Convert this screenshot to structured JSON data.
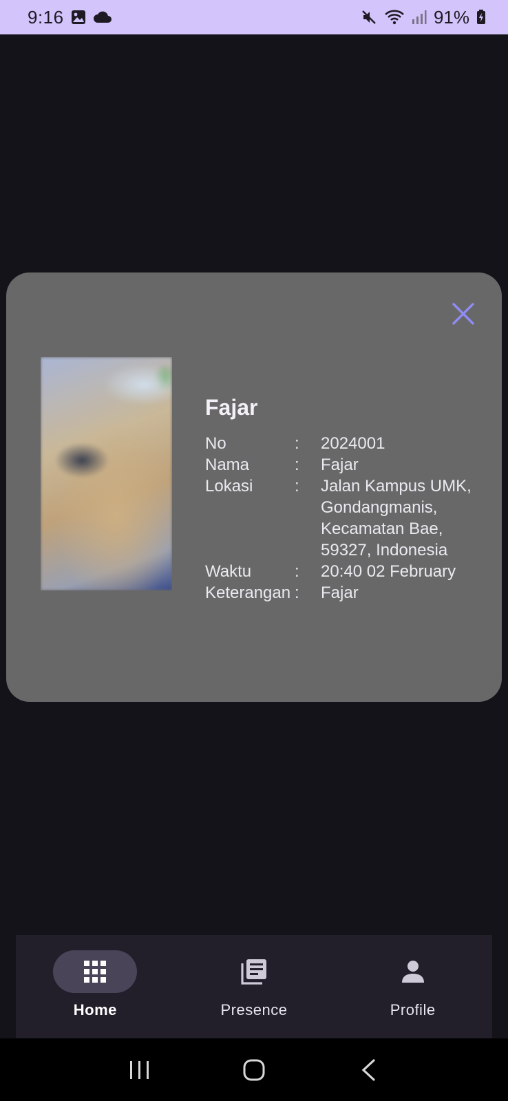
{
  "status_bar": {
    "time": "9:16",
    "battery": "91%",
    "icons": [
      "gallery-icon",
      "cloud-icon",
      "mute-icon",
      "wifi-icon",
      "signal-icon",
      "battery-charging-icon"
    ]
  },
  "dialog": {
    "close_icon": "close-icon",
    "photo_alt": "presence photo",
    "name": "Fajar",
    "rows": [
      {
        "label": "No",
        "sep": ":",
        "value": "2024001"
      },
      {
        "label": "Nama",
        "sep": ":",
        "value": "Fajar"
      },
      {
        "label": "Lokasi",
        "sep": ":",
        "value": "Jalan Kampus UMK, Gondangmanis, Kecamatan Bae, 59327, Indonesia"
      },
      {
        "label": "Waktu",
        "sep": ":",
        "value": "20:40 02 February"
      },
      {
        "label": "Keterangan",
        "sep": ":",
        "value": "Fajar"
      }
    ]
  },
  "bottom_nav": {
    "items": [
      {
        "label": "Home",
        "icon": "grid-icon",
        "active": true
      },
      {
        "label": "Presence",
        "icon": "list-icon",
        "active": false
      },
      {
        "label": "Profile",
        "icon": "person-icon",
        "active": false
      }
    ]
  },
  "system_nav": {
    "icons": [
      "recent-apps-icon",
      "home-icon",
      "back-icon"
    ]
  },
  "colors": {
    "status_bar_bg": "#d3c4fb",
    "screen_bg": "#15131a",
    "dialog_bg": "#686868",
    "close_accent": "#8f8cf5",
    "nav_bg": "#221f2a",
    "nav_active_pill": "#4a4458"
  }
}
